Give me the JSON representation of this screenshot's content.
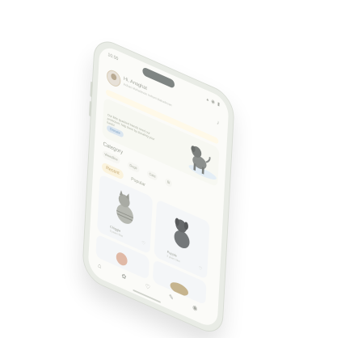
{
  "status": {
    "time": "10:00",
    "icons": "▴ ◉ ▮"
  },
  "profile": {
    "name": "Hi, Anaghat",
    "subtitle": "Indrani Mahadevan\nIndrani Mahadevan"
  },
  "banner": {
    "text": "Our little sparkled friends need our protection; help them by donating your funds!",
    "button": "Donate"
  },
  "category": {
    "title": "Category",
    "items": [
      "Weedline",
      "Dogs",
      "Cats",
      "Bi"
    ]
  },
  "tabs": [
    "Recent",
    "Popular"
  ],
  "pets": [
    {
      "name": "Chiggle",
      "sub": "3 years 5km"
    },
    {
      "name": "Pupple",
      "sub": "2 years 5km"
    }
  ],
  "nav_icons": [
    "home-icon",
    "paw-icon",
    "heart-icon",
    "chat-icon",
    "profile-icon"
  ],
  "colors": {
    "accent": "#c4a974",
    "donate": "#7fa4c5",
    "frame": "#e9ece6"
  }
}
